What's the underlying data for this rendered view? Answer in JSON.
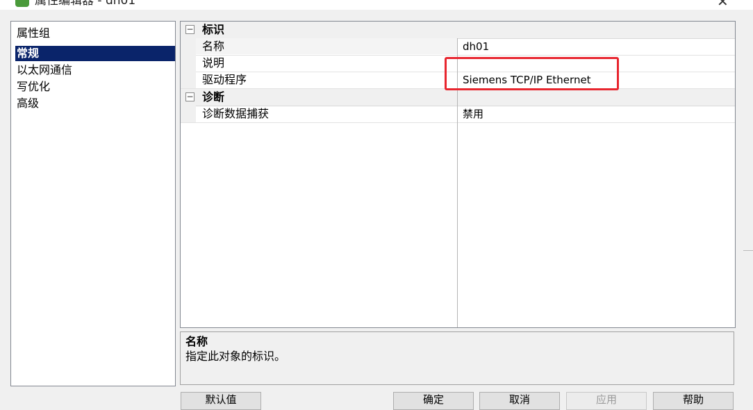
{
  "window": {
    "title": "属性编辑器 - dh01",
    "close_glyph": "✕",
    "accent": "#4a9a3a"
  },
  "left": {
    "header": "属性组",
    "items": [
      {
        "label": "常规",
        "selected": true
      },
      {
        "label": "以太网通信",
        "selected": false
      },
      {
        "label": "写优化",
        "selected": false
      },
      {
        "label": "高级",
        "selected": false
      }
    ]
  },
  "grid": {
    "categories": [
      {
        "label": "标识",
        "toggle": "−",
        "properties": [
          {
            "name": "名称",
            "value": "dh01"
          },
          {
            "name": "说明",
            "value": ""
          },
          {
            "name": "驱动程序",
            "value": "Siemens TCP/IP Ethernet"
          }
        ]
      },
      {
        "label": "诊断",
        "toggle": "−",
        "properties": [
          {
            "name": "诊断数据捕获",
            "value": "禁用"
          }
        ]
      }
    ],
    "highlight_color": "#e8262f"
  },
  "description": {
    "title": "名称",
    "text": "指定此对象的标识。"
  },
  "buttons": {
    "defaults": "默认值",
    "ok": "确定",
    "cancel": "取消",
    "apply": "应用",
    "help": "帮助"
  }
}
